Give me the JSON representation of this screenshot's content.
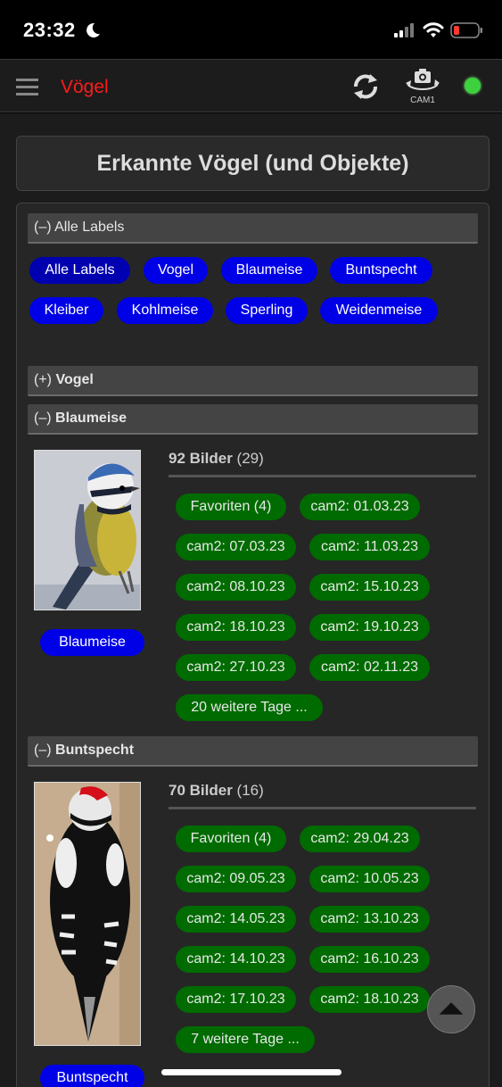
{
  "status_bar": {
    "time": "23:32"
  },
  "app": {
    "title": "Vögel",
    "cam_label": "CAM1",
    "status_color": "#3ed13e"
  },
  "page_title": "Erkannte Vögel (und Objekte)",
  "labels_section": {
    "header_toggle": "(–)",
    "header_label": "Alle Labels",
    "chips": [
      "Alle Labels",
      "Vogel",
      "Blaumeise",
      "Buntspecht",
      "Kleiber",
      "Kohlmeise",
      "Sperling",
      "Weidenmeise"
    ]
  },
  "sections": [
    {
      "toggle": "(+)",
      "name": "Vogel"
    },
    {
      "toggle": "(–)",
      "name": "Blaumeise",
      "count_bold": "92 Bilder",
      "count_paren": "(29)",
      "label_button": "Blaumeise",
      "days": [
        "Favoriten (4)",
        "cam2: 01.03.23",
        "cam2: 07.03.23",
        "cam2: 11.03.23",
        "cam2: 08.10.23",
        "cam2: 15.10.23",
        "cam2: 18.10.23",
        "cam2: 19.10.23",
        "cam2: 27.10.23",
        "cam2: 02.11.23",
        "20 weitere Tage ..."
      ]
    },
    {
      "toggle": "(–)",
      "name": "Buntspecht",
      "count_bold": "70 Bilder",
      "count_paren": "(16)",
      "label_button": "Buntspecht",
      "days": [
        "Favoriten (4)",
        "cam2: 29.04.23",
        "cam2: 09.05.23",
        "cam2: 10.05.23",
        "cam2: 14.05.23",
        "cam2: 13.10.23",
        "cam2: 14.10.23",
        "cam2: 16.10.23",
        "cam2: 17.10.23",
        "cam2: 18.10.23",
        "7 weitere Tage ..."
      ]
    }
  ],
  "colors": {
    "title_red": "#ff1a1a",
    "chip_blue": "#0000e6",
    "chip_green": "#006b00",
    "background": "#1c1c1c"
  },
  "icons": [
    "moon-icon",
    "signal-icon",
    "wifi-icon",
    "battery-icon",
    "menu-icon",
    "refresh-icon",
    "camera-switch-icon",
    "arrow-up-icon"
  ]
}
